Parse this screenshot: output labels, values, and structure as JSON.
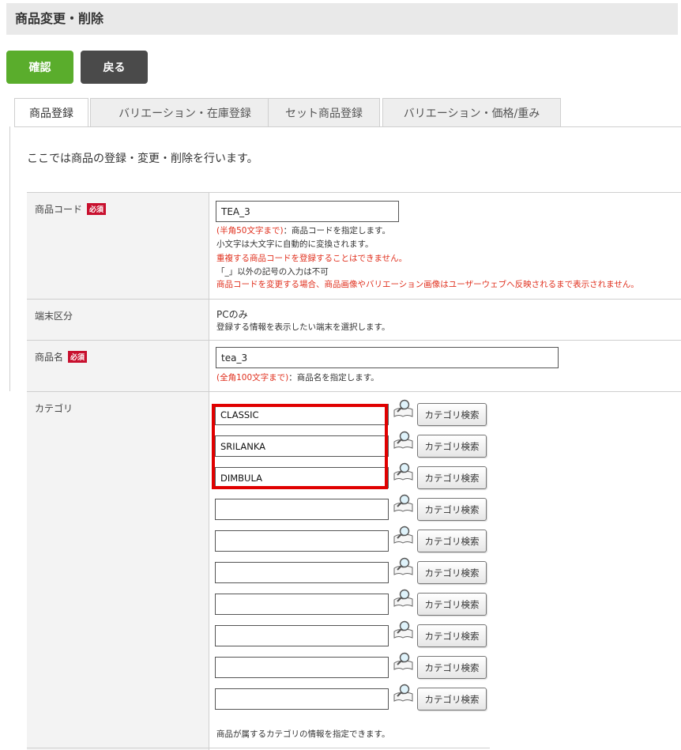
{
  "header": {
    "title": "商品変更・削除"
  },
  "actions": {
    "confirm_label": "確認",
    "back_label": "戻る"
  },
  "tabs": [
    {
      "label": "商品登録",
      "active": true
    },
    {
      "label": "バリエーション・在庫登録"
    },
    {
      "label": "セット商品登録"
    },
    {
      "label": "バリエーション・価格/重み"
    }
  ],
  "intro": "ここでは商品の登録・変更・削除を行います。",
  "required_badge": "必須",
  "product_code": {
    "label": "商品コード",
    "value": "TEA_3",
    "note1_limit": "(半角50文字まで)",
    "note1_text": "：商品コードを指定します。",
    "note2": "小文字は大文字に自動的に変換されます。",
    "note3": "重複する商品コードを登録することはできません。",
    "note4": "「_」以外の記号の入力は不可",
    "note5": "商品コードを変更する場合、商品画像やバリエーション画像はユーザーウェブへ反映されるまで表示されません。"
  },
  "device": {
    "label": "端末区分",
    "value": "PCのみ",
    "note": "登録する情報を表示したい端末を選択します。"
  },
  "product_name": {
    "label": "商品名",
    "value": "tea_3",
    "note_limit": "(全角100文字まで)",
    "note_text": "：商品名を指定します。"
  },
  "category": {
    "label": "カテゴリ",
    "search_label": "カテゴリ検索",
    "values": [
      "CLASSIC",
      "SRILANKA",
      "DIMBULA",
      "",
      "",
      "",
      "",
      "",
      "",
      ""
    ],
    "note": "商品が属するカテゴリの情報を指定できます。"
  },
  "colors": {
    "confirm": "#5aad2c",
    "back": "#4a4a4a",
    "required": "#c8102e",
    "note_red": "#e0301e",
    "highlight": "#e00000"
  }
}
